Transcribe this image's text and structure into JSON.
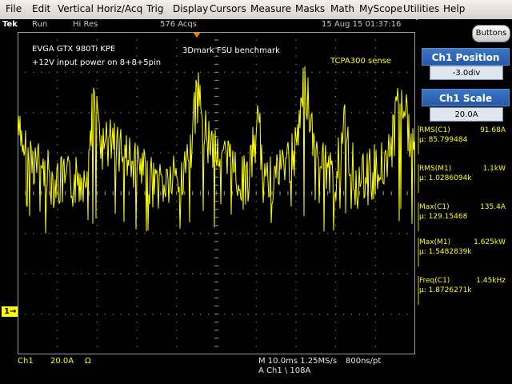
{
  "menu": [
    "File",
    "Edit",
    "Vertical",
    "Horiz/Acq",
    "Trig",
    "Display",
    "Cursors",
    "Measure",
    "Masks",
    "Math",
    "MyScope",
    "Utilities",
    "Help"
  ],
  "status": {
    "brand": "Tek",
    "run": "Run",
    "mode": "Hi Res",
    "acqs": "576 Acqs",
    "datetime": "15 Aug 15 01:37:16"
  },
  "labels": {
    "card": "EVGA GTX 980Ti KPE",
    "power": "+12V input power on 8+8+5pin",
    "bench": "3Dmark FSU benchmark",
    "probe": "TCPA300 sense"
  },
  "channel_marker": "1",
  "panel": {
    "buttons": "Buttons",
    "position_title": "Ch1 Position",
    "position_value": "-3.0div",
    "scale_title": "Ch1 Scale",
    "scale_value": "20.0A"
  },
  "measurements": [
    {
      "name": "RMS(C1)",
      "value": "91.68A",
      "mu": "µ: 85.799484"
    },
    {
      "name": "RMS(M1)",
      "value": "1.1kW",
      "mu": "µ: 1.0286094k"
    },
    {
      "name": "Max(C1)",
      "value": "135.4A",
      "mu": "µ: 129.15468"
    },
    {
      "name": "Max(M1)",
      "value": "1.625kW",
      "mu": "µ: 1.5482839k"
    },
    {
      "name": "Freq(C1)",
      "value": "1.45kHz",
      "mu": "µ: 1.8726271k"
    }
  ],
  "bottom": {
    "ch": "Ch1",
    "scale": "20.0A",
    "ohm": "Ω",
    "timebase": "M 10.0ms 1.25MS/s",
    "res": "800ns/pt",
    "trig": "A  Ch1  \\  108A"
  },
  "colors": {
    "trace": "#ffff00",
    "accent": "#2e6bc0",
    "menu_bg": "#e4e1dd"
  }
}
